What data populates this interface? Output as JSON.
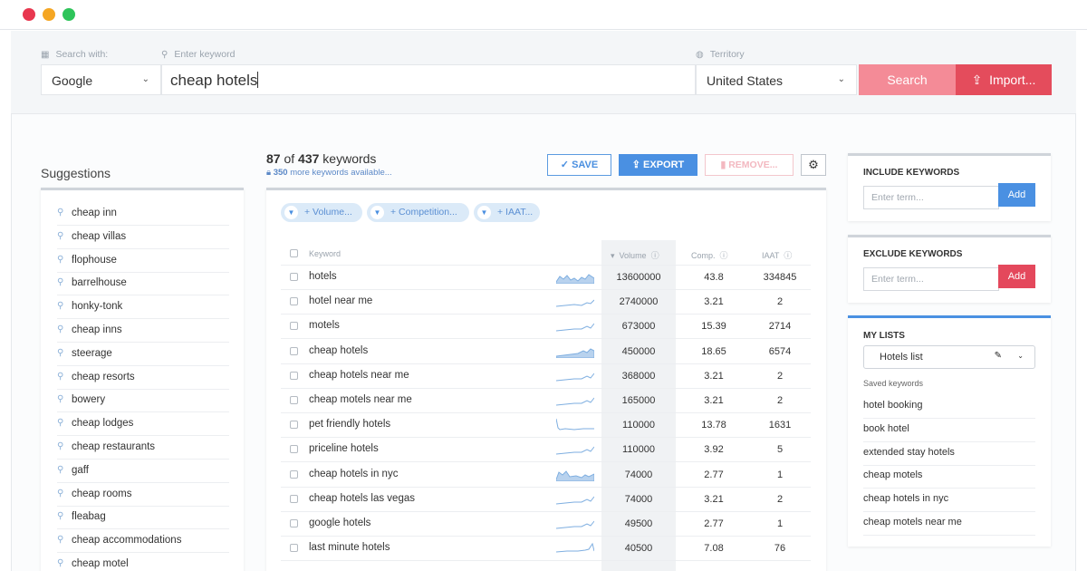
{
  "search": {
    "search_with_label": "Search with:",
    "engine": "Google",
    "keyword_label": "Enter keyword",
    "keyword_value": "cheap hotels",
    "territory_label": "Territory",
    "territory": "United States",
    "search_button": "Search",
    "import_button": "Import..."
  },
  "suggestions": {
    "title": "Suggestions",
    "items": [
      "cheap inn",
      "cheap villas",
      "flophouse",
      "barrelhouse",
      "honky-tonk",
      "cheap inns",
      "steerage",
      "cheap resorts",
      "bowery",
      "cheap lodges",
      "cheap restaurants",
      "gaff",
      "cheap rooms",
      "fleabag",
      "cheap accommodations",
      "cheap motel"
    ]
  },
  "results": {
    "shown": "87",
    "of_text": "of",
    "total": "437",
    "keywords_word": "keywords",
    "more_count": "350",
    "more_text": "more keywords available...",
    "save_button": "SAVE",
    "export_button": "EXPORT",
    "remove_button": "REMOVE...",
    "filters": [
      "+ Volume...",
      "+ Competition...",
      "+ IAAT..."
    ],
    "columns": {
      "keyword": "Keyword",
      "volume": "Volume",
      "comp": "Comp.",
      "iaat": "IAAT"
    },
    "rows": [
      {
        "keyword": "hotels",
        "volume": "13600000",
        "comp": "43.8",
        "iaat": "334845"
      },
      {
        "keyword": "hotel near me",
        "volume": "2740000",
        "comp": "3.21",
        "iaat": "2"
      },
      {
        "keyword": "motels",
        "volume": "673000",
        "comp": "15.39",
        "iaat": "2714"
      },
      {
        "keyword": "cheap hotels",
        "volume": "450000",
        "comp": "18.65",
        "iaat": "6574"
      },
      {
        "keyword": "cheap hotels near me",
        "volume": "368000",
        "comp": "3.21",
        "iaat": "2"
      },
      {
        "keyword": "cheap motels near me",
        "volume": "165000",
        "comp": "3.21",
        "iaat": "2"
      },
      {
        "keyword": "pet friendly hotels",
        "volume": "110000",
        "comp": "13.78",
        "iaat": "1631"
      },
      {
        "keyword": "priceline hotels",
        "volume": "110000",
        "comp": "3.92",
        "iaat": "5"
      },
      {
        "keyword": "cheap hotels in nyc",
        "volume": "74000",
        "comp": "2.77",
        "iaat": "1"
      },
      {
        "keyword": "cheap hotels las vegas",
        "volume": "74000",
        "comp": "3.21",
        "iaat": "2"
      },
      {
        "keyword": "google hotels",
        "volume": "49500",
        "comp": "2.77",
        "iaat": "1"
      },
      {
        "keyword": "last minute hotels",
        "volume": "40500",
        "comp": "7.08",
        "iaat": "76"
      }
    ]
  },
  "include": {
    "title": "INCLUDE KEYWORDS",
    "placeholder": "Enter term...",
    "add": "Add"
  },
  "exclude": {
    "title": "EXCLUDE KEYWORDS",
    "placeholder": "Enter term...",
    "add": "Add"
  },
  "lists": {
    "title": "MY LISTS",
    "selected": "Hotels list",
    "saved_label": "Saved keywords",
    "saved": [
      "hotel booking",
      "book hotel",
      "extended stay hotels",
      "cheap motels",
      "cheap hotels in nyc",
      "cheap motels near me"
    ]
  },
  "colors": {
    "accent_blue": "#4a90e2",
    "accent_red": "#e44c5c",
    "search_pink": "#f48b97"
  }
}
